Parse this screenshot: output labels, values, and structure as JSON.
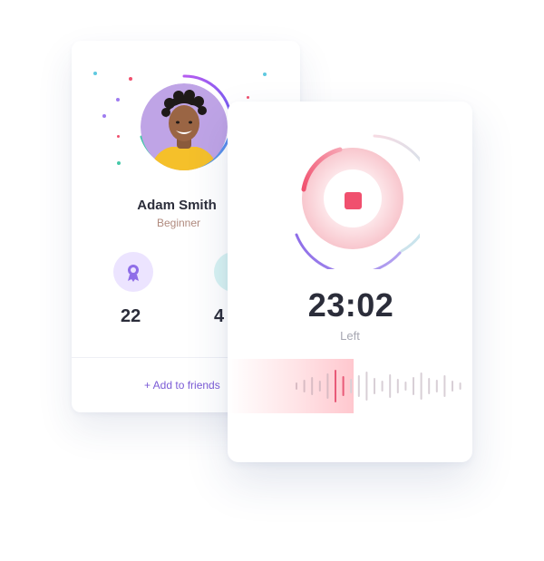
{
  "profile": {
    "name": "Adam Smith",
    "level": "Beginner",
    "stats": [
      {
        "icon": "award-icon",
        "value": "22"
      },
      {
        "icon": "stat-icon",
        "value": "4"
      }
    ],
    "add_friends_label": "+ Add to friends"
  },
  "player": {
    "timer": "23:02",
    "caption": "Left",
    "progress": 0.6,
    "stop_icon": "stop-icon"
  },
  "colors": {
    "accent_purple": "#7b5bd6",
    "accent_pink": "#f0506e",
    "accent_cyan": "#6fd6e0",
    "text_dark": "#2b2d3a",
    "text_muted": "#a6a7b2",
    "level_text": "#b08a7e"
  }
}
